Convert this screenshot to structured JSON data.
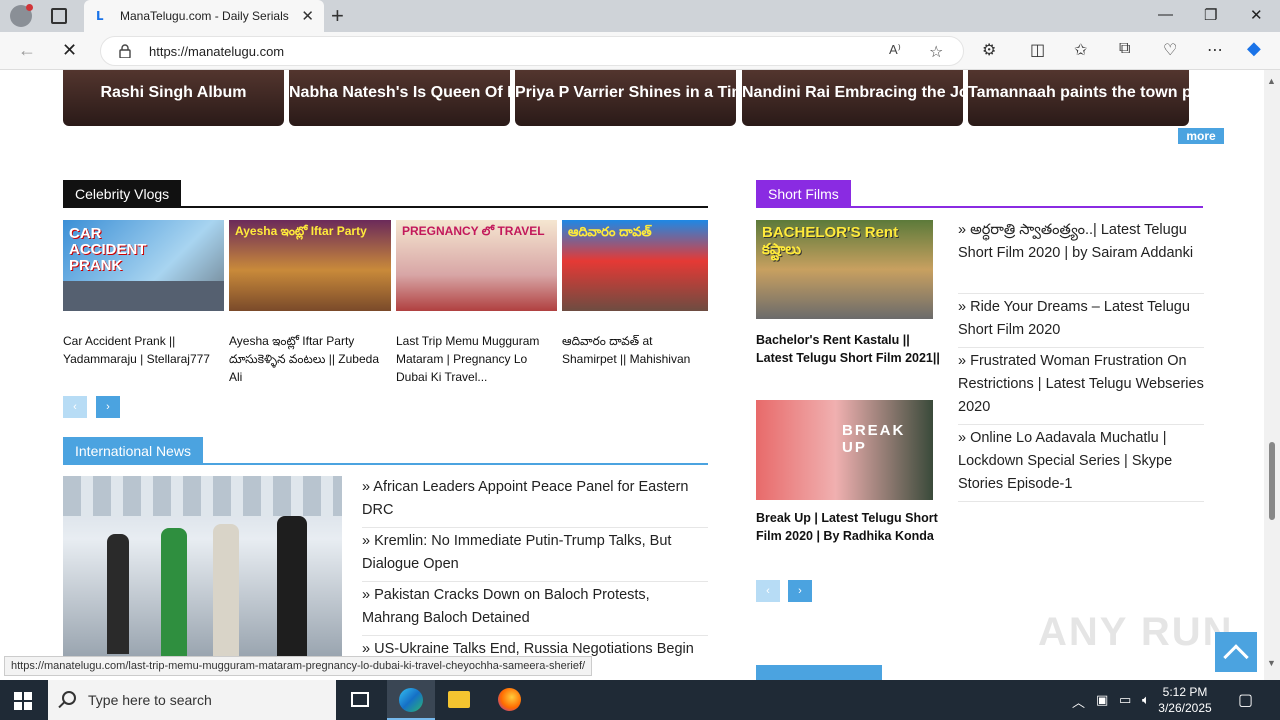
{
  "browser": {
    "tab_title": "ManaTelugu.com - Daily Serials |",
    "url": "https://manatelugu.com",
    "min_label": "—",
    "max_label": "❐",
    "close_label": "✕"
  },
  "gallery": {
    "cards": [
      {
        "caption": "Rashi Singh Album"
      },
      {
        "caption": "Nabha Natesh's Is Queen Of Hearts"
      },
      {
        "caption": "Priya P Varrier Shines in a Timeless Photoshoot"
      },
      {
        "caption": "Nandini Rai Embracing the Journey with Style"
      },
      {
        "caption": "Tamannaah paints the town pink in style!"
      }
    ],
    "more_label": "more"
  },
  "celebrity_vlogs": {
    "heading": "Celebrity Vlogs",
    "color": "#111111",
    "items": [
      {
        "title": "Car Accident Prank || Yadammaraju | Stellaraj777",
        "thumb_text": "CAR ACCIDENT PRANK"
      },
      {
        "title": "Ayesha ఇంట్లో Iftar Party దూసుకెళ్ళిన వంటలు || Zubeda Ali",
        "thumb_text": "Ayesha ఇంట్లో Iftar Party"
      },
      {
        "title": "Last Trip Memu Mugguram Mataram | Pregnancy Lo Dubai Ki Travel...",
        "thumb_text": "PREGNANCY లో TRAVEL"
      },
      {
        "title": "ఆదివారం దావత్ at Shamirpet || Mahishivan",
        "thumb_text": "ఆదివారం దావత్"
      }
    ],
    "prev_label": "‹",
    "next_label": "›"
  },
  "international_news": {
    "heading": "International News",
    "color": "#4ba3e0",
    "items": [
      "African Leaders Appoint Peace Panel for Eastern DRC",
      "Kremlin: No Immediate Putin-Trump Talks, But Dialogue Open",
      "Pakistan Cracks Down on Baloch Protests, Mahrang Baloch Detained",
      "US-Ukraine Talks End, Russia Negotiations Begin"
    ]
  },
  "short_films": {
    "heading": "Short Films",
    "color": "#8a2be2",
    "cards": [
      {
        "title": "Bachelor's Rent Kastalu || Latest Telugu Short Film 2021||",
        "thumb_text": "BACHELOR'S Rent కష్టాలు"
      },
      {
        "title": "Break Up | Latest Telugu Short Film 2020 | By Radhika Konda",
        "thumb_text": "BREAK UP"
      }
    ],
    "list": [
      "అర్ధరాత్రి స్వాతంత్ర్యం..| Latest Telugu Short Film 2020 | by Sairam Addanki",
      "Ride Your Dreams – Latest Telugu Short Film 2020",
      "Frustrated Woman Frustration On Restrictions | Latest Telugu Webseries 2020",
      "Online Lo Aadavala Muchatlu | Lockdown Special Series | Skype Stories Episode-1"
    ],
    "prev_label": "‹",
    "next_label": "›"
  },
  "status_url": "https://manatelugu.com/last-trip-memu-mugguram-mataram-pregnancy-lo-dubai-ki-travel-cheyochha-sameera-sherief/",
  "watermark": "ANY RUN",
  "taskbar": {
    "search_placeholder": "Type here to search",
    "time": "5:12 PM",
    "date": "3/26/2025"
  }
}
